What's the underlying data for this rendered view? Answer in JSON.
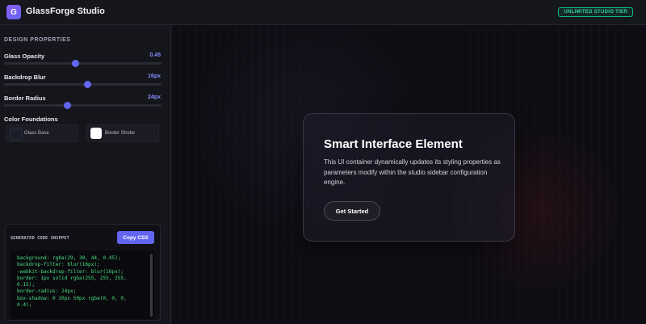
{
  "app": {
    "logo_letter": "G",
    "title": "GlassForge Studio",
    "tier_badge": "UNLIMITED STUDIO TIER",
    "accent": "#6366f1",
    "badge_color": "#10b981"
  },
  "sidebar": {
    "section_title": "DESIGN PROPERTIES",
    "controls": [
      {
        "label": "Glass Opacity",
        "value": "0.45",
        "level": 0.45
      },
      {
        "label": "Backdrop Blur",
        "value": "16px",
        "level": 0.53
      },
      {
        "label": "Border Radius",
        "value": "24px",
        "level": 0.4
      }
    ],
    "colors_title": "Color Foundations",
    "swatches": [
      {
        "label": "Glass Base",
        "color": "#1d1e2c"
      },
      {
        "label": "Border Stroke",
        "color": "#ffffff"
      }
    ]
  },
  "code": {
    "title": "GENERATED CODE SNIPPET",
    "copy_label": "Copy CSS",
    "lines": "background: rgba(29, 30, 44, 0.45);\nbackdrop-filter: blur(16px);\n-webkit-backdrop-filter: blur(16px);\nborder: 1px solid rgba(255, 255, 255,\n0.15);\nborder-radius: 24px;\nbox-shadow: 0 20px 50px rgba(0, 0, 0,\n0.4);"
  },
  "card": {
    "title": "Smart Interface Element",
    "text": "This UI container dynamically updates its styling properties as parameters modify within the studio sidebar configuration engine.",
    "button_label": "Get Started"
  }
}
